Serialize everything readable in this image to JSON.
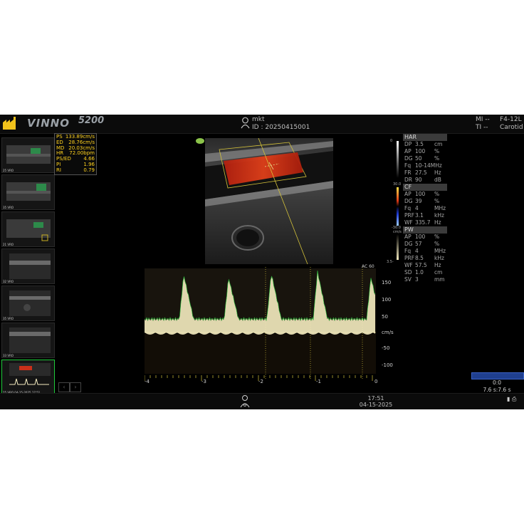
{
  "header": {
    "brand": "VINNO",
    "brand_model": "5200",
    "operator": "mkt",
    "patient_id": "ID : 20250415001",
    "mi": "MI --",
    "ti": "TI --",
    "probe": "F4-12L",
    "preset": "Carotid"
  },
  "thumbnails": [
    {
      "label": "25 VRO"
    },
    {
      "label": "35 VRO"
    },
    {
      "label": "21 VRO"
    },
    {
      "label": "32 VRO"
    },
    {
      "label": "35 VRO"
    },
    {
      "label": "33 VRO"
    },
    {
      "label": "25 VRO 04-15-2025 17:51",
      "active": true
    }
  ],
  "measurements": [
    {
      "k": "PS",
      "v": "133.89cm/s"
    },
    {
      "k": "ED",
      "v": "28.76cm/s"
    },
    {
      "k": "MD",
      "v": "20.03cm/s"
    },
    {
      "k": "HR",
      "v": "72.00bpm"
    },
    {
      "k": "PS/ED",
      "v": "4.66"
    },
    {
      "k": "PI",
      "v": "1.96"
    },
    {
      "k": "RI",
      "v": "0.79"
    }
  ],
  "params": {
    "har": {
      "title": "HAR",
      "rows": [
        {
          "k": "DP",
          "v": "3.5",
          "u": "cm"
        },
        {
          "k": "AP",
          "v": "100",
          "u": "%"
        },
        {
          "k": "DG",
          "v": "50",
          "u": "%"
        },
        {
          "k": "Fq",
          "v": "10-14MHz",
          "u": ""
        },
        {
          "k": "FR",
          "v": "27.5",
          "u": "Hz"
        },
        {
          "k": "DR",
          "v": "90",
          "u": "dB"
        }
      ]
    },
    "cf": {
      "title": "CF",
      "rows": [
        {
          "k": "AP",
          "v": "100",
          "u": "%"
        },
        {
          "k": "DG",
          "v": "39",
          "u": "%"
        },
        {
          "k": "Fq",
          "v": "4",
          "u": "MHz"
        },
        {
          "k": "PRF",
          "v": "3.1",
          "u": "kHz"
        },
        {
          "k": "WF",
          "v": "335.7",
          "u": "Hz"
        }
      ]
    },
    "pw": {
      "title": "PW",
      "rows": [
        {
          "k": "AP",
          "v": "100",
          "u": "%"
        },
        {
          "k": "DG",
          "v": "57",
          "u": "%"
        },
        {
          "k": "Fq",
          "v": "4",
          "u": "MHz"
        },
        {
          "k": "PRF",
          "v": "8.5",
          "u": "kHz"
        },
        {
          "k": "WF",
          "v": "57.5",
          "u": "Hz"
        },
        {
          "k": "SD",
          "v": "1.0",
          "u": "cm"
        },
        {
          "k": "SV",
          "v": "3",
          "u": "mm"
        }
      ]
    }
  },
  "colorbar": {
    "top": "30.0",
    "bottom": "-30.0",
    "unit": "cm/s",
    "gray_top": "0",
    "gray_bottom": "3.5-"
  },
  "doppler": {
    "ac_label": "AC 60",
    "unit": "cm/s",
    "y_ticks": [
      "150",
      "100",
      "50",
      "-50",
      "-100"
    ],
    "x_ticks": [
      "-4",
      "-3",
      "-2",
      "-1",
      "0"
    ]
  },
  "sweep": {
    "top": "0:0",
    "bottom": "7.6 s:7.6 s"
  },
  "clock": {
    "time": "17:51",
    "date": "04-15-2025"
  },
  "colors": {
    "accent_green": "#1ecb3a",
    "meas_yellow": "#ffd21e",
    "doppler_cream": "#f5ecc0"
  }
}
